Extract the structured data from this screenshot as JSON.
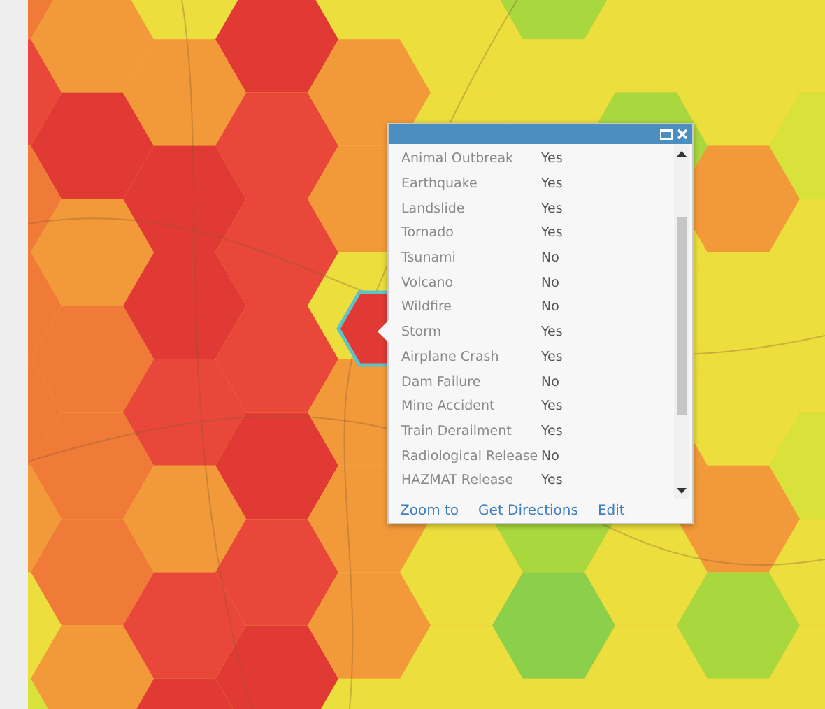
{
  "popup": {
    "rows": [
      {
        "name": "Animal Outbreak",
        "value": "Yes"
      },
      {
        "name": "Earthquake",
        "value": "Yes"
      },
      {
        "name": "Landslide",
        "value": "Yes"
      },
      {
        "name": "Tornado",
        "value": "Yes"
      },
      {
        "name": "Tsunami",
        "value": "No"
      },
      {
        "name": "Volcano",
        "value": "No"
      },
      {
        "name": "Wildfire",
        "value": "No"
      },
      {
        "name": "Storm",
        "value": "Yes"
      },
      {
        "name": "Airplane Crash",
        "value": "Yes"
      },
      {
        "name": "Dam Failure",
        "value": "No"
      },
      {
        "name": "Mine Accident",
        "value": "Yes"
      },
      {
        "name": "Train Derailment",
        "value": "Yes"
      },
      {
        "name": "Radiological Release",
        "value": "No"
      },
      {
        "name": "HAZMAT Release",
        "value": "Yes"
      }
    ],
    "actions": [
      "Zoom to",
      "Get Directions",
      "Edit"
    ]
  }
}
